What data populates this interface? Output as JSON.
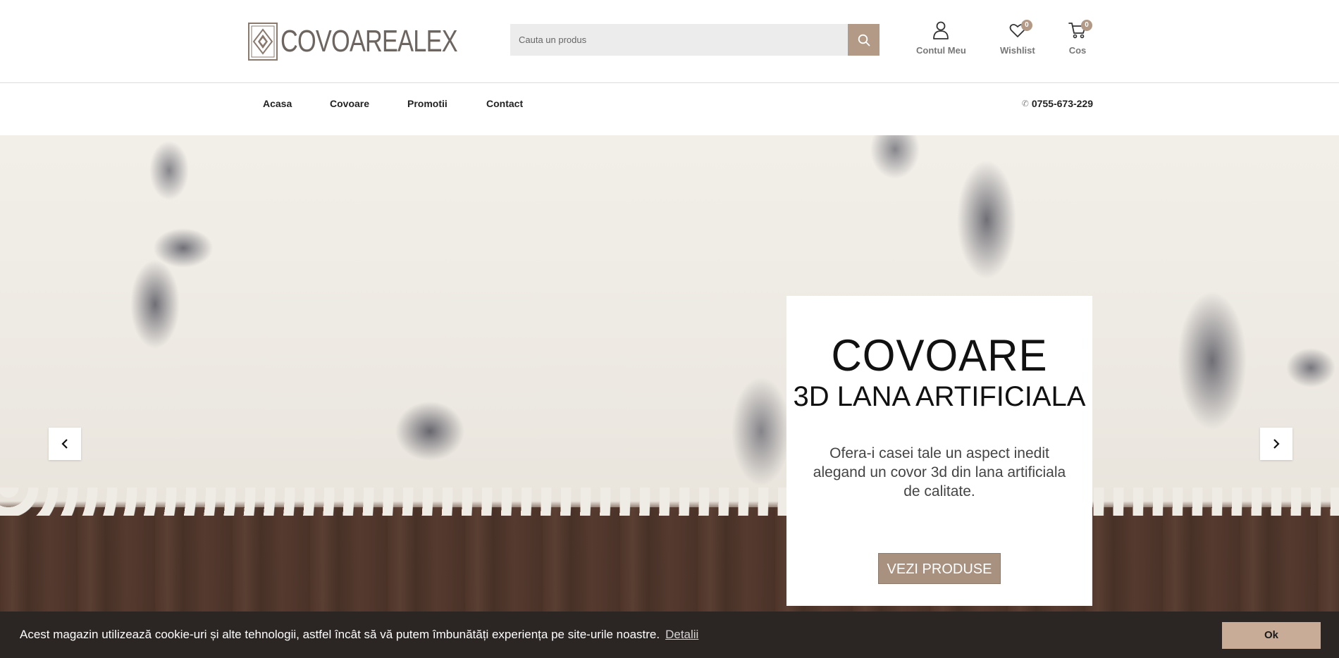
{
  "header": {
    "logo_text": "COVOAREALEX",
    "search_placeholder": "Cauta un produs",
    "account_label": "Contul Meu",
    "wishlist_label": "Wishlist",
    "wishlist_count": "0",
    "cart_label": "Cos",
    "cart_count": "0"
  },
  "nav": {
    "items": [
      {
        "label": "Acasa"
      },
      {
        "label": "Covoare"
      },
      {
        "label": "Promotii"
      },
      {
        "label": "Contact"
      }
    ],
    "phone": "0755-673-229"
  },
  "hero": {
    "title": "COVOARE",
    "subtitle": "3D LANA ARTIFICIALA",
    "description": "Ofera-i casei tale un aspect inedit alegand un covor 3d din lana artificiala de calitate.",
    "button_label": "VEZI PRODUSE"
  },
  "cookie": {
    "text": "Acest magazin utilizează cookie-uri și alte tehnologii, astfel încât să vă putem îmbunătăți experiența pe site-urile noastre.",
    "link_label": "Detalii",
    "ok_label": "Ok"
  },
  "colors": {
    "accent": "#b39a87",
    "cookie_bg": "#2b2624",
    "cookie_button": "#c9ac98"
  }
}
